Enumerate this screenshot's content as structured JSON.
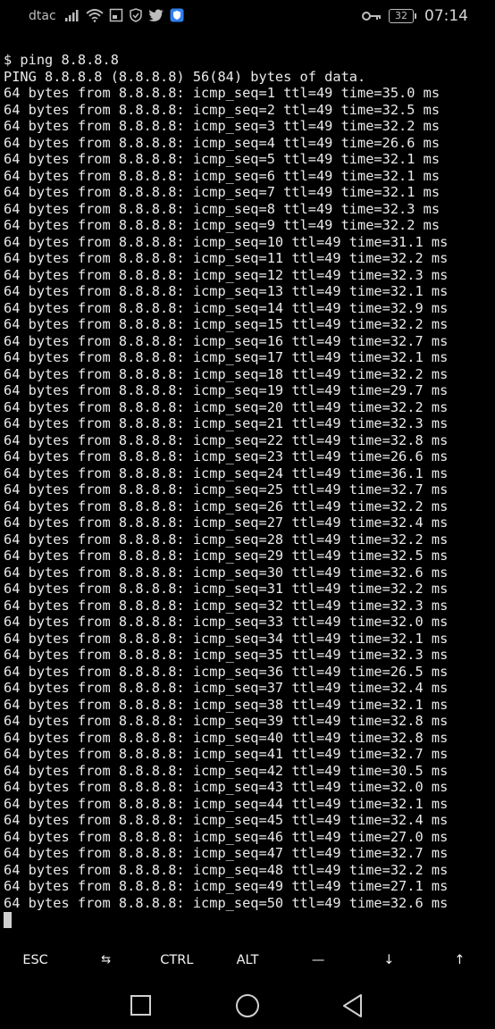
{
  "status_bar": {
    "carrier": "dtac",
    "battery": "32",
    "time": "07:14",
    "icons": [
      "signal-icon",
      "wifi-icon",
      "screenshot-icon",
      "shield-icon",
      "twitter-icon",
      "security-app-icon",
      "key-icon",
      "battery-icon"
    ]
  },
  "terminal": {
    "lines": [
      "$ ping 8.8.8.8",
      "PING 8.8.8.8 (8.8.8.8) 56(84) bytes of data.",
      "64 bytes from 8.8.8.8: icmp_seq=1 ttl=49 time=35.0 ms",
      "64 bytes from 8.8.8.8: icmp_seq=2 ttl=49 time=32.5 ms",
      "64 bytes from 8.8.8.8: icmp_seq=3 ttl=49 time=32.2 ms",
      "64 bytes from 8.8.8.8: icmp_seq=4 ttl=49 time=26.6 ms",
      "64 bytes from 8.8.8.8: icmp_seq=5 ttl=49 time=32.1 ms",
      "64 bytes from 8.8.8.8: icmp_seq=6 ttl=49 time=32.1 ms",
      "64 bytes from 8.8.8.8: icmp_seq=7 ttl=49 time=32.1 ms",
      "64 bytes from 8.8.8.8: icmp_seq=8 ttl=49 time=32.3 ms",
      "64 bytes from 8.8.8.8: icmp_seq=9 ttl=49 time=32.2 ms",
      "64 bytes from 8.8.8.8: icmp_seq=10 ttl=49 time=31.1 ms",
      "64 bytes from 8.8.8.8: icmp_seq=11 ttl=49 time=32.2 ms",
      "64 bytes from 8.8.8.8: icmp_seq=12 ttl=49 time=32.3 ms",
      "64 bytes from 8.8.8.8: icmp_seq=13 ttl=49 time=32.1 ms",
      "64 bytes from 8.8.8.8: icmp_seq=14 ttl=49 time=32.9 ms",
      "64 bytes from 8.8.8.8: icmp_seq=15 ttl=49 time=32.2 ms",
      "64 bytes from 8.8.8.8: icmp_seq=16 ttl=49 time=32.7 ms",
      "64 bytes from 8.8.8.8: icmp_seq=17 ttl=49 time=32.1 ms",
      "64 bytes from 8.8.8.8: icmp_seq=18 ttl=49 time=32.2 ms",
      "64 bytes from 8.8.8.8: icmp_seq=19 ttl=49 time=29.7 ms",
      "64 bytes from 8.8.8.8: icmp_seq=20 ttl=49 time=32.2 ms",
      "64 bytes from 8.8.8.8: icmp_seq=21 ttl=49 time=32.3 ms",
      "64 bytes from 8.8.8.8: icmp_seq=22 ttl=49 time=32.8 ms",
      "64 bytes from 8.8.8.8: icmp_seq=23 ttl=49 time=26.6 ms",
      "64 bytes from 8.8.8.8: icmp_seq=24 ttl=49 time=36.1 ms",
      "64 bytes from 8.8.8.8: icmp_seq=25 ttl=49 time=32.7 ms",
      "64 bytes from 8.8.8.8: icmp_seq=26 ttl=49 time=32.2 ms",
      "64 bytes from 8.8.8.8: icmp_seq=27 ttl=49 time=32.4 ms",
      "64 bytes from 8.8.8.8: icmp_seq=28 ttl=49 time=32.2 ms",
      "64 bytes from 8.8.8.8: icmp_seq=29 ttl=49 time=32.5 ms",
      "64 bytes from 8.8.8.8: icmp_seq=30 ttl=49 time=32.6 ms",
      "64 bytes from 8.8.8.8: icmp_seq=31 ttl=49 time=32.2 ms",
      "64 bytes from 8.8.8.8: icmp_seq=32 ttl=49 time=32.3 ms",
      "64 bytes from 8.8.8.8: icmp_seq=33 ttl=49 time=32.0 ms",
      "64 bytes from 8.8.8.8: icmp_seq=34 ttl=49 time=32.1 ms",
      "64 bytes from 8.8.8.8: icmp_seq=35 ttl=49 time=32.3 ms",
      "64 bytes from 8.8.8.8: icmp_seq=36 ttl=49 time=26.5 ms",
      "64 bytes from 8.8.8.8: icmp_seq=37 ttl=49 time=32.4 ms",
      "64 bytes from 8.8.8.8: icmp_seq=38 ttl=49 time=32.1 ms",
      "64 bytes from 8.8.8.8: icmp_seq=39 ttl=49 time=32.8 ms",
      "64 bytes from 8.8.8.8: icmp_seq=40 ttl=49 time=32.8 ms",
      "64 bytes from 8.8.8.8: icmp_seq=41 ttl=49 time=32.7 ms",
      "64 bytes from 8.8.8.8: icmp_seq=42 ttl=49 time=30.5 ms",
      "64 bytes from 8.8.8.8: icmp_seq=43 ttl=49 time=32.0 ms",
      "64 bytes from 8.8.8.8: icmp_seq=44 ttl=49 time=32.1 ms",
      "64 bytes from 8.8.8.8: icmp_seq=45 ttl=49 time=32.4 ms",
      "64 bytes from 8.8.8.8: icmp_seq=46 ttl=49 time=27.0 ms",
      "64 bytes from 8.8.8.8: icmp_seq=47 ttl=49 time=32.7 ms",
      "64 bytes from 8.8.8.8: icmp_seq=48 ttl=49 time=32.2 ms",
      "64 bytes from 8.8.8.8: icmp_seq=49 ttl=49 time=27.1 ms",
      "64 bytes from 8.8.8.8: icmp_seq=50 ttl=49 time=32.6 ms"
    ]
  },
  "extra_keys": {
    "esc": "ESC",
    "tab": "⇆",
    "ctrl": "CTRL",
    "alt": "ALT",
    "dash": "—",
    "down": "↓",
    "up": "↑"
  },
  "nav_bar": {
    "icons": [
      "recents-square-icon",
      "home-circle-icon",
      "back-triangle-icon"
    ]
  },
  "colors": {
    "background": "#000000",
    "text": "#eaeaea",
    "accent_shield": "#2f80ed"
  }
}
